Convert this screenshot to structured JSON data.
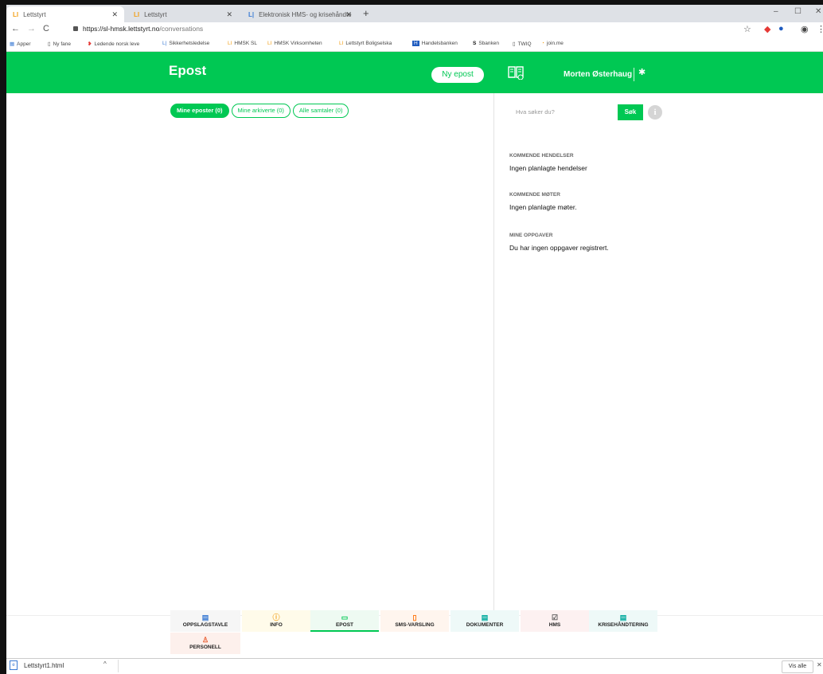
{
  "browser": {
    "tabs": [
      {
        "title": "Lettstyrt",
        "active": true
      },
      {
        "title": "Lettstyrt",
        "active": false
      },
      {
        "title": "Elektronisk HMS- og krisehåndte",
        "active": false
      }
    ],
    "url_host": "https://sl-hmsk.lettstyrt.no",
    "url_path": "/conversations",
    "bookmarks": [
      {
        "label": "Apper",
        "icon": "grid-icon"
      },
      {
        "label": "Ny fane",
        "icon": "page-icon"
      },
      {
        "label": "Ledende norsk leve",
        "icon": "red-logo-icon"
      },
      {
        "label": "Sikkerhetsledelse",
        "icon": "lettstyrt-icon"
      },
      {
        "label": "HMSK SL",
        "icon": "lettstyrt-icon"
      },
      {
        "label": "HMSK Virksomheten",
        "icon": "lettstyrt-icon"
      },
      {
        "label": "Lettstyrt Boligselska",
        "icon": "lettstyrt-icon"
      },
      {
        "label": "Handelsbanken",
        "icon": "hb-icon"
      },
      {
        "label": "Sbanken",
        "icon": "s-icon"
      },
      {
        "label": "TWIQ",
        "icon": "page-icon"
      },
      {
        "label": "join.me",
        "icon": "joinme-icon"
      }
    ]
  },
  "app": {
    "title": "Epost",
    "new_button": "Ny epost",
    "user_name": "Morten Østerhaug",
    "accent": "#00c853"
  },
  "filters": [
    {
      "label": "Mine eposter (0)",
      "active": true
    },
    {
      "label": "Mine arkiverte (0)",
      "active": false
    },
    {
      "label": "Alle samtaler (0)",
      "active": false
    }
  ],
  "sidebar": {
    "search_placeholder": "Hva søker du?",
    "search_button": "Søk",
    "sections": [
      {
        "heading": "KOMMENDE HENDELSER",
        "text": "Ingen planlagte hendelser"
      },
      {
        "heading": "KOMMENDE MØTER",
        "text": "Ingen planlagte møter."
      },
      {
        "heading": "MINE OPPGAVER",
        "text": "Du har ingen oppgaver registrert."
      }
    ]
  },
  "bottom_nav": [
    {
      "label": "OPPSLAGSTAVLE",
      "icon": "board-icon",
      "bg": "#f6f6f6",
      "color": "#3b7bd4"
    },
    {
      "label": "INFO",
      "icon": "info-icon",
      "bg": "#fffbea",
      "color": "#f3a11b"
    },
    {
      "label": "EPOST",
      "icon": "chat-icon",
      "bg": "#eefaf2",
      "color": "#00c853",
      "selected": true
    },
    {
      "label": "SMS-VARSLING",
      "icon": "phone-icon",
      "bg": "#fff5ee",
      "color": "#ff6d00"
    },
    {
      "label": "DOKUMENTER",
      "icon": "document-icon",
      "bg": "#eef9f8",
      "color": "#00a99d"
    },
    {
      "label": "HMS",
      "icon": "checklist-icon",
      "bg": "#fdf1f1",
      "color": "#555555"
    },
    {
      "label": "KRISEHÅNDTERING",
      "icon": "crisis-icon",
      "bg": "#eef9f8",
      "color": "#00a99d"
    },
    {
      "label": "PERSONELL",
      "icon": "person-icon",
      "bg": "#fdf0ec",
      "color": "#e8582a"
    }
  ],
  "downloads": {
    "file": "Lettstyrt1.html",
    "show_all": "Vis alle"
  }
}
